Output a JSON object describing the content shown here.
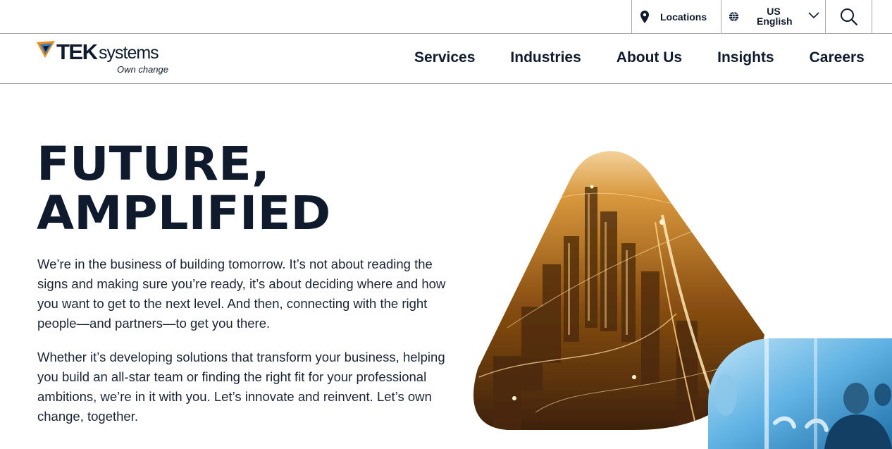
{
  "utility": {
    "locations_label": "Locations",
    "lang_region": "US",
    "lang_language": "English",
    "icons": [
      "map-pin-icon",
      "globe-icon",
      "chevron-down-icon",
      "search-icon"
    ]
  },
  "logo": {
    "brand_bold": "TEK",
    "brand_light": "systems",
    "tagline": "Own change"
  },
  "nav": {
    "items": [
      "Services",
      "Industries",
      "About Us",
      "Insights",
      "Careers"
    ]
  },
  "hero": {
    "title_line1": "FUTURE,",
    "title_line2": "AMPLIFIED",
    "paragraph1": "We’re in the business of building tomorrow. It’s not about reading the signs and making sure you’re ready, it’s about deciding where and how you want to get to the next level. And then, connecting with the right people—and partners—to get you there.",
    "paragraph2": "Whether it’s developing solutions that transform your business, helping you build an all-star team or finding the right fit for your professional ambitions, we’re in it with you. Let’s innovate and reinvent. Let’s own change, together."
  },
  "colors": {
    "text_dark": "#0f1b2d",
    "border": "#a9a9a9",
    "image_amber": "#c8801e",
    "inset_blue": "#4aa6dc",
    "logo_orange": "#f08a1e",
    "logo_blue": "#2b7fc1"
  }
}
